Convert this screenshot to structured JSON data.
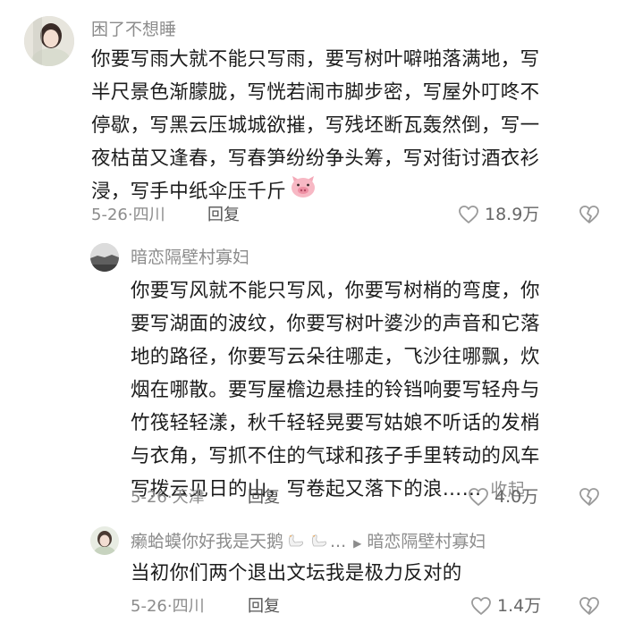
{
  "comments": [
    {
      "username": "困了不想睡",
      "lines": [
        "你要写雨大就不能只写雨，要写树叶噼啪落满地，写",
        "半尺景色渐朦胧，写恍若闹市脚步密，写屋外叮咚不",
        "停歇，写黑云压城城欲摧，写残坯断瓦轰然倒，写一",
        "夜枯苗又逢春，写春笋纷纷争头筹，写对街讨酒衣衫",
        "浸，写手中纸伞压千斤"
      ],
      "date": "5-26",
      "location": "四川",
      "reply_label": "回复",
      "likes": "18.9万"
    },
    {
      "username": "暗恋隔壁村寡妇",
      "lines": [
        "你要写风就不能只写风，你要写树梢的弯度，你",
        "要写湖面的波纹，你要写树叶婆沙的声音和它落",
        "地的路径，你要写云朵往哪走，飞沙往哪飘，炊",
        "烟在哪散。要写屋檐边悬挂的铃铛响要写轻舟与",
        "竹筏轻轻漾，秋千轻轻晃要写姑娘不听话的发梢",
        "与衣角，写抓不住的气球和孩子手里转动的风车",
        "写拨云见日的山，写卷起又落下的浪……"
      ],
      "collapse_label": "收起",
      "date": "5-26",
      "location": "天津",
      "reply_label": "回复",
      "likes": "4.0万"
    },
    {
      "username": "癞蛤蟆你好我是天鹅",
      "username_suffix": "...",
      "reply_to": "暗恋隔壁村寡妇",
      "lines": [
        "当初你们两个退出文坛我是极力反对的"
      ],
      "date": "5-26",
      "location": "四川",
      "reply_label": "回复",
      "likes": "1.4万"
    }
  ],
  "icons": {
    "like": "heart-outline-icon",
    "dislike": "broken-heart-icon",
    "emoji": "pig-face-emoji",
    "reply_arrow": "play-arrow-icon",
    "swan": "swan-emoji"
  },
  "colors": {
    "text": "#1c1c1c",
    "muted": "#8c8c8c",
    "icon": "#9a9a9a"
  }
}
